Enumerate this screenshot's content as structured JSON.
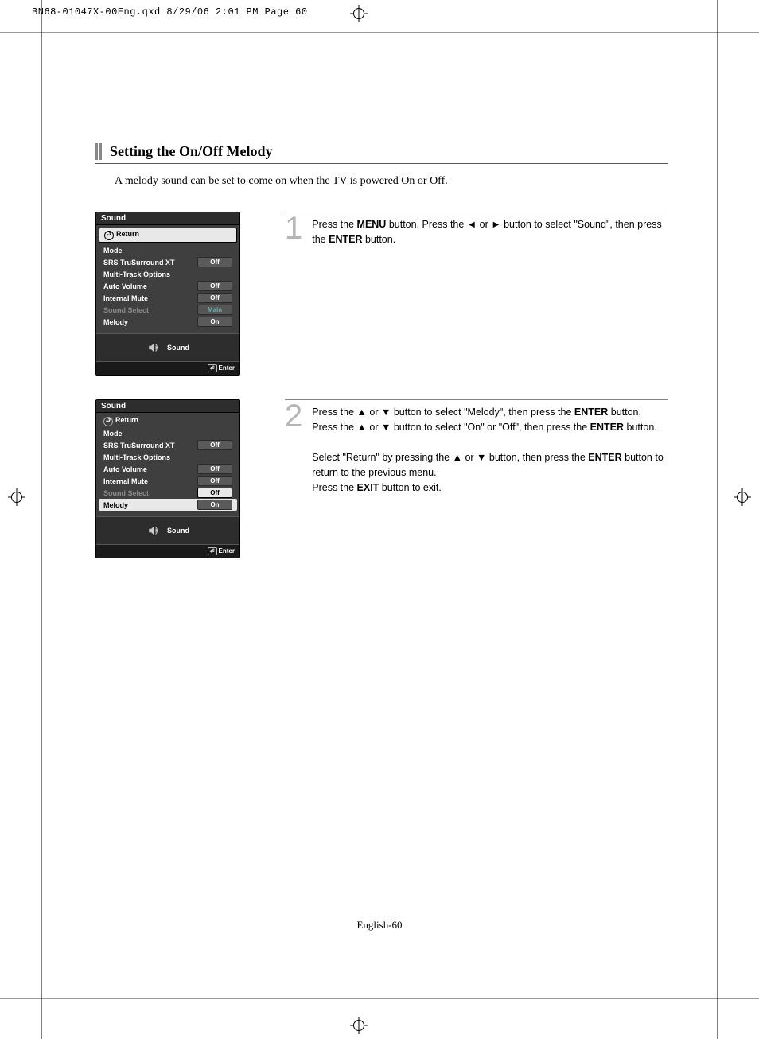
{
  "print_header": "BN68-01047X-00Eng.qxd  8/29/06  2:01 PM  Page 60",
  "title": "Setting the On/Off Melody",
  "intro": "A melody sound can be set to come on when the TV is powered On or Off.",
  "footer_page": "English-60",
  "menu": {
    "title": "Sound",
    "footer_label": "Sound",
    "enter_label": "Enter",
    "return_label": "Return",
    "rows": {
      "mode": "Mode",
      "srs": "SRS TruSurround XT",
      "multi": "Multi-Track Options",
      "auto_vol": "Auto Volume",
      "int_mute": "Internal Mute",
      "sound_sel": "Sound Select",
      "melody": "Melody"
    },
    "values": {
      "srs": "Off",
      "auto_vol": "Off",
      "int_mute": "Off",
      "sound_sel_main": "Main",
      "sound_sel_off": "Off",
      "melody": "On"
    }
  },
  "steps": {
    "s1": {
      "num": "1",
      "p1a": "Press the ",
      "p1b": "MENU",
      "p1c": " button. Press the ",
      "p1d": " or ",
      "p1e": " button to select \"Sound\", then press the ",
      "p1f": "ENTER",
      "p1g": " button."
    },
    "s2": {
      "num": "2",
      "p1a": "Press the ",
      "p1b": " or ",
      "p1c": " button to select \"Melody\", then press the ",
      "p1d": "ENTER",
      "p1e": " button.",
      "p2a": "Press the ",
      "p2b": " or ",
      "p2c": " button to select \"On\" or \"Off\", then press the ",
      "p2d": "ENTER",
      "p2e": " button.",
      "p3a": "Select \"Return\" by pressing the ",
      "p3b": " or ",
      "p3c": " button, then press the ",
      "p3d": "ENTER",
      "p3e": " button to return to the previous menu.",
      "p4a": "Press the ",
      "p4b": "EXIT",
      "p4c": " button to exit."
    }
  }
}
